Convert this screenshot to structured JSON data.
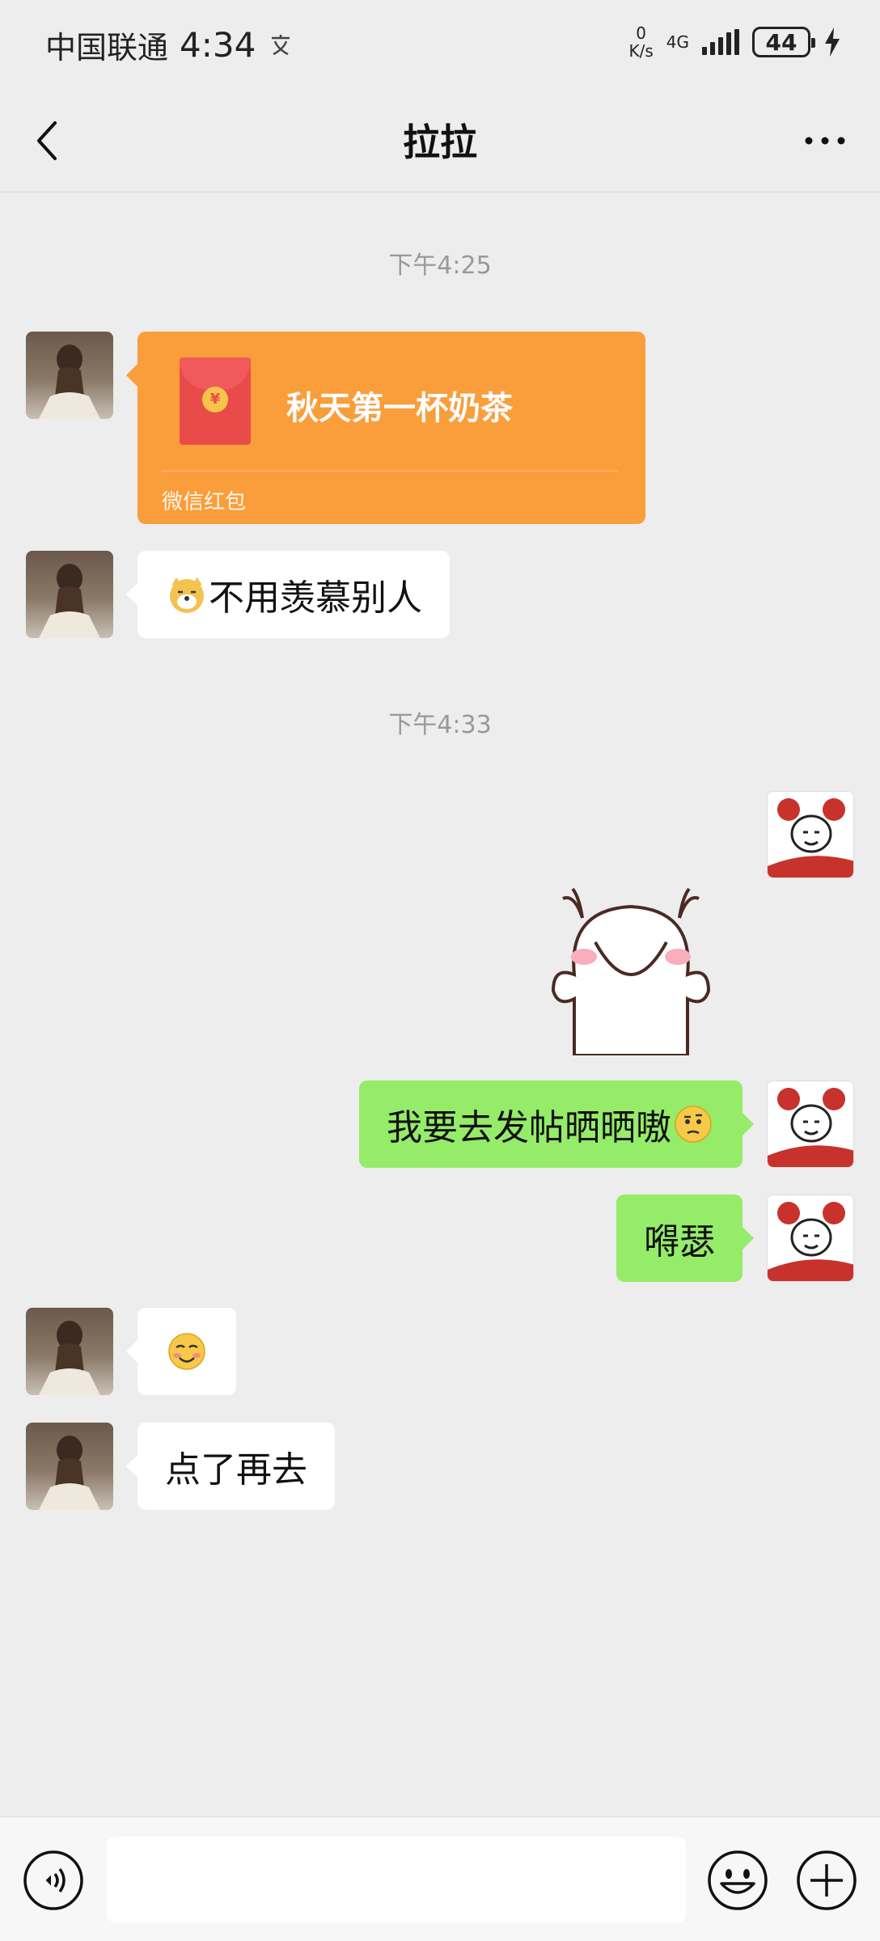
{
  "status_bar": {
    "carrier": "中国联通",
    "time": "4:34",
    "net_speed_value": "0",
    "net_speed_unit": "K/s",
    "network": "4G",
    "battery": "44"
  },
  "header": {
    "title": "拉拉"
  },
  "messages": {
    "ts1": "下午4:25",
    "redpacket_title": "秋天第一杯奶茶",
    "redpacket_label": "微信红包",
    "msg1_text": "不用羡慕别人",
    "ts2": "下午4:33",
    "msg3_text": "我要去发帖晒晒嗷",
    "msg4_text": "嘚瑟",
    "msg6_text": "点了再去"
  },
  "input": {
    "placeholder": ""
  },
  "colors": {
    "background": "#ededed",
    "bubble_me": "#95ec69",
    "bubble_other": "#ffffff",
    "redpacket": "#fa9d3b"
  },
  "icons": {
    "back": "back-icon",
    "more": "more-icon",
    "voice": "voice-icon",
    "emoji": "emoji-icon",
    "plus": "plus-icon"
  }
}
